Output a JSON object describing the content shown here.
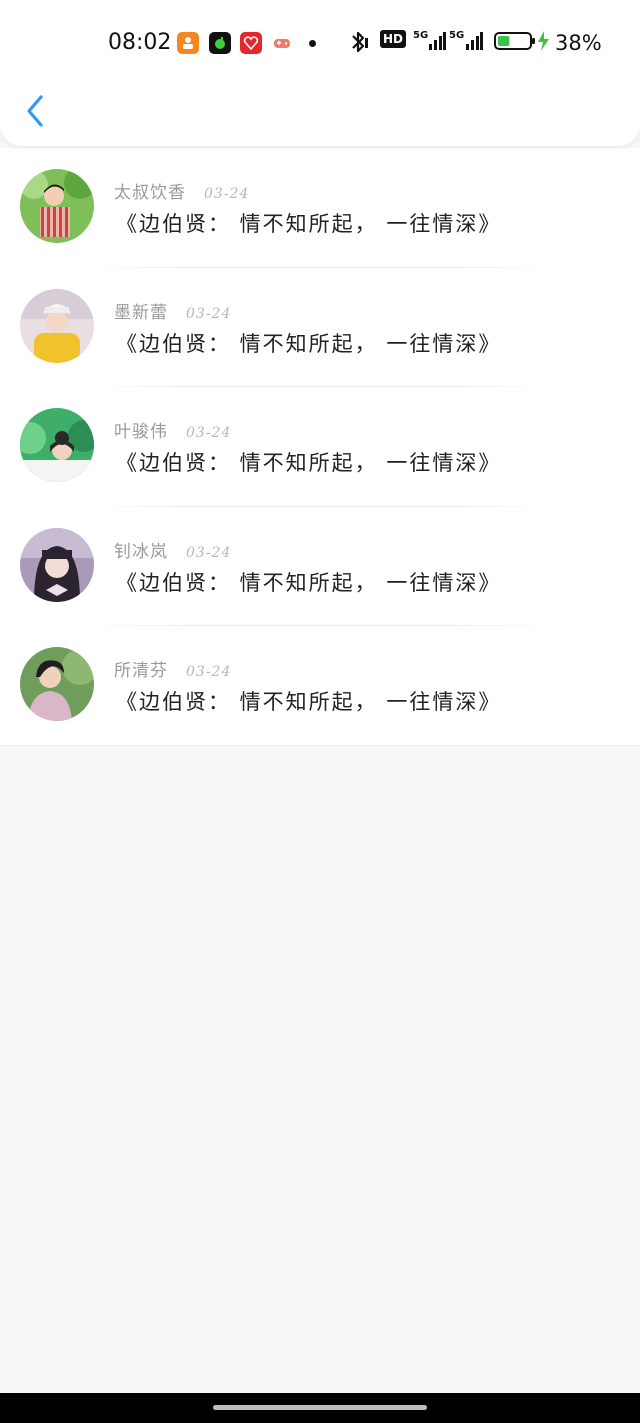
{
  "status_bar": {
    "time": "08:02",
    "hd_label": "HD",
    "net1_label": "5G",
    "net2_label": "5G",
    "battery_percent": "38%",
    "battery_level": 0.38
  },
  "header": {
    "back_icon": "chevron-left-icon",
    "accent_color": "#2f9bf0"
  },
  "items": [
    {
      "name": "太叔饮香",
      "date": "03-24",
      "title": "《边伯贤： 情不知所起， 一往情深》"
    },
    {
      "name": "墨新蕾",
      "date": "03-24",
      "title": "《边伯贤： 情不知所起， 一往情深》"
    },
    {
      "name": "叶骏伟",
      "date": "03-24",
      "title": "《边伯贤： 情不知所起， 一往情深》"
    },
    {
      "name": "钊冰岚",
      "date": "03-24",
      "title": "《边伯贤： 情不知所起， 一往情深》"
    },
    {
      "name": "所清芬",
      "date": "03-24",
      "title": "《边伯贤： 情不知所起， 一往情深》"
    }
  ]
}
